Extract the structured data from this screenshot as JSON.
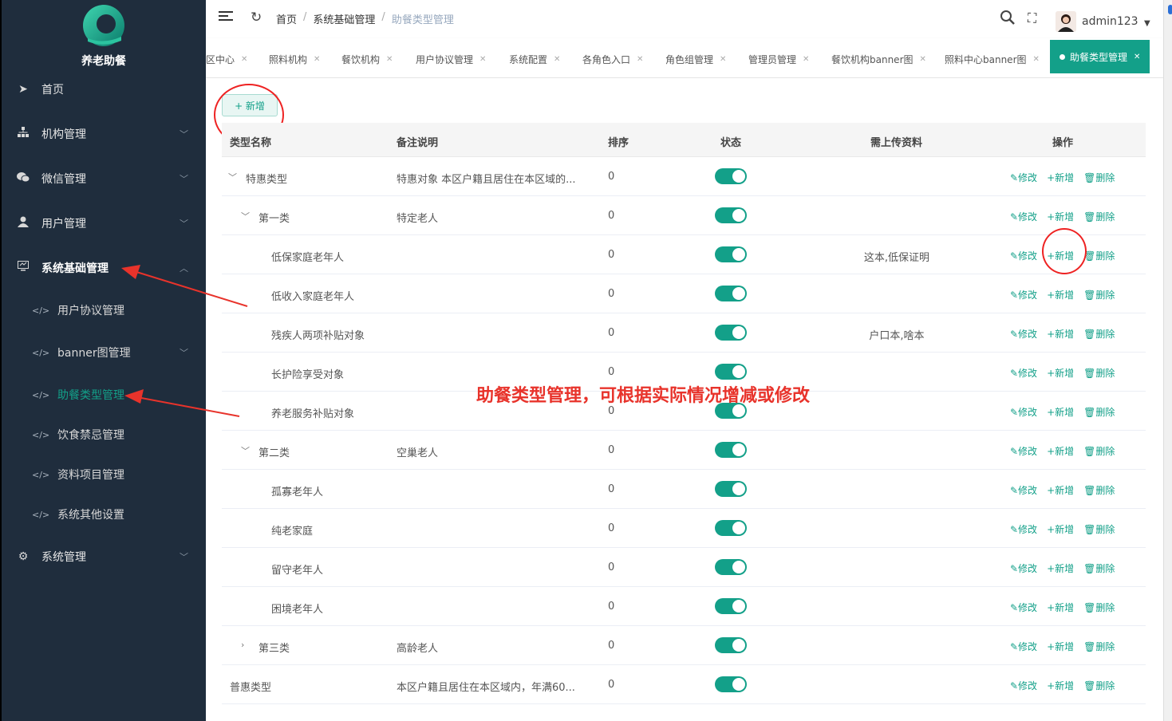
{
  "app": {
    "logo_text": "养老助餐"
  },
  "sidebar": {
    "items": [
      {
        "label": "首页",
        "icon": "paper-plane-icon"
      },
      {
        "label": "机构管理",
        "icon": "sitemap-icon"
      },
      {
        "label": "微信管理",
        "icon": "wechat-icon"
      },
      {
        "label": "用户管理",
        "icon": "user-icon"
      },
      {
        "label": "系统基础管理",
        "icon": "monitor-icon"
      },
      {
        "label": "系统管理",
        "icon": "gear-icon"
      }
    ],
    "subitems": [
      {
        "label": "用户协议管理"
      },
      {
        "label": "banner图管理"
      },
      {
        "label": "助餐类型管理"
      },
      {
        "label": "饮食禁忌管理"
      },
      {
        "label": "资料项目管理"
      },
      {
        "label": "系统其他设置"
      }
    ]
  },
  "header": {
    "breadcrumb": [
      "首页",
      "系统基础管理",
      "助餐类型管理"
    ],
    "username": "admin123"
  },
  "tabs": [
    {
      "label": "区中心"
    },
    {
      "label": "照料机构"
    },
    {
      "label": "餐饮机构"
    },
    {
      "label": "用户协议管理"
    },
    {
      "label": "系统配置"
    },
    {
      "label": "各角色入口"
    },
    {
      "label": "角色组管理"
    },
    {
      "label": "管理员管理"
    },
    {
      "label": "餐饮机构banner图"
    },
    {
      "label": "照料中心banner图"
    },
    {
      "label": "助餐类型管理"
    }
  ],
  "main": {
    "add_button": "+ 新增",
    "columns": [
      "类型名称",
      "备注说明",
      "排序",
      "状态",
      "需上传资料",
      "操作"
    ],
    "ops": {
      "edit": "✎修改",
      "add": "+新增",
      "delete": "🗑删除"
    },
    "rows": [
      {
        "name": "特惠类型",
        "note": "特惠对象 本区户籍且居住在本区域的...",
        "sort": "0",
        "docs": ""
      },
      {
        "name": "第一类",
        "note": "特定老人",
        "sort": "0",
        "docs": ""
      },
      {
        "name": "低保家庭老年人",
        "note": "",
        "sort": "0",
        "docs": "这本,低保证明"
      },
      {
        "name": "低收入家庭老年人",
        "note": "",
        "sort": "0",
        "docs": ""
      },
      {
        "name": "残疾人两项补贴对象",
        "note": "",
        "sort": "0",
        "docs": "户口本,啥本"
      },
      {
        "name": "长护险享受对象",
        "note": "",
        "sort": "0",
        "docs": ""
      },
      {
        "name": "养老服务补贴对象",
        "note": "",
        "sort": "0",
        "docs": ""
      },
      {
        "name": "第二类",
        "note": "空巢老人",
        "sort": "0",
        "docs": ""
      },
      {
        "name": "孤寡老年人",
        "note": "",
        "sort": "0",
        "docs": ""
      },
      {
        "name": "纯老家庭",
        "note": "",
        "sort": "0",
        "docs": ""
      },
      {
        "name": "留守老年人",
        "note": "",
        "sort": "0",
        "docs": ""
      },
      {
        "name": "困境老年人",
        "note": "",
        "sort": "0",
        "docs": ""
      },
      {
        "name": "第三类",
        "note": "高龄老人",
        "sort": "0",
        "docs": ""
      },
      {
        "name": "普惠类型",
        "note": "本区户籍且居住在本区域内，年满60...",
        "sort": "0",
        "docs": ""
      }
    ]
  },
  "annotation": "助餐类型管理，可根据实际情况增减或修改",
  "colors": {
    "accent": "#13a089",
    "sidebar_bg": "#1f2d3d",
    "annotation": "#e8332b"
  }
}
